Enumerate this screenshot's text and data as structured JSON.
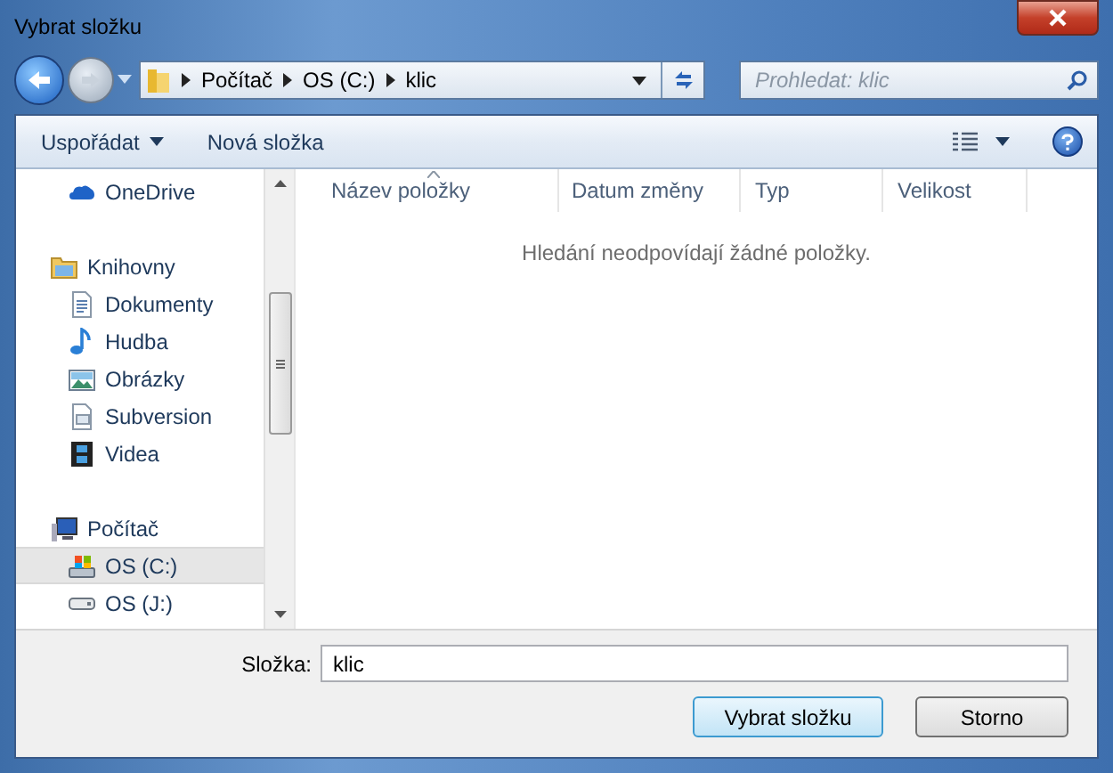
{
  "window": {
    "title": "Vybrat složku"
  },
  "address": {
    "crumbs": [
      "Počítač",
      "OS (C:)",
      "klic"
    ]
  },
  "search": {
    "placeholder": "Prohledat: klic"
  },
  "toolbar": {
    "buttons": [
      "Uspořádat",
      "Nová složka"
    ]
  },
  "sidebar": {
    "sections": [
      {
        "children": [
          {
            "label": "OneDrive",
            "selected": false
          }
        ]
      },
      {
        "label": "Knihovny",
        "children": [
          {
            "label": "Dokumenty",
            "selected": false
          },
          {
            "label": "Hudba",
            "selected": false
          },
          {
            "label": "Obrázky",
            "selected": false
          },
          {
            "label": "Subversion",
            "selected": false
          },
          {
            "label": "Videa",
            "selected": false
          }
        ]
      },
      {
        "label": "Počítač",
        "children": [
          {
            "label": "OS (C:)",
            "selected": true
          },
          {
            "label": "OS (J:)",
            "selected": false
          }
        ]
      }
    ]
  },
  "table": {
    "columns": [
      "Název položky",
      "Datum změny",
      "Typ",
      "Velikost"
    ],
    "empty_message": "Hledání neodpovídají žádné položky."
  },
  "folder_field": {
    "label": "Složka:",
    "value": "klic"
  },
  "buttons": [
    "Vybrat složku",
    "Storno"
  ]
}
